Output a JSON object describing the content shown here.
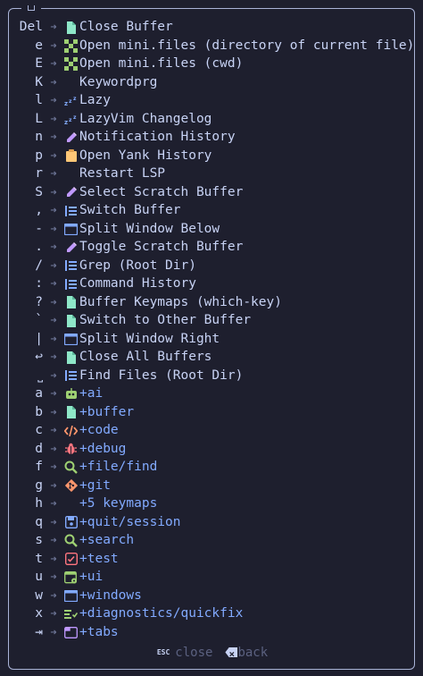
{
  "items": [
    {
      "key": "Del",
      "icon": "file",
      "label": "Close Buffer",
      "group": false
    },
    {
      "key": "e",
      "icon": "minifiles",
      "label": "Open mini.files (directory of current file)",
      "group": false
    },
    {
      "key": "E",
      "icon": "minifiles",
      "label": "Open mini.files (cwd)",
      "group": false
    },
    {
      "key": "K",
      "icon": "none",
      "label": "Keywordprg",
      "group": false
    },
    {
      "key": "l",
      "icon": "zzz",
      "label": "Lazy",
      "group": false
    },
    {
      "key": "L",
      "icon": "zzz",
      "label": "LazyVim Changelog",
      "group": false
    },
    {
      "key": "n",
      "icon": "note",
      "label": "Notification History",
      "group": false
    },
    {
      "key": "p",
      "icon": "clipboard",
      "label": "Open Yank History",
      "group": false
    },
    {
      "key": "r",
      "icon": "none",
      "label": "Restart LSP",
      "group": false
    },
    {
      "key": "S",
      "icon": "note",
      "label": "Select Scratch Buffer",
      "group": false
    },
    {
      "key": ",",
      "icon": "list",
      "label": "Switch Buffer",
      "group": false
    },
    {
      "key": "-",
      "icon": "window",
      "label": "Split Window Below",
      "group": false
    },
    {
      "key": ".",
      "icon": "note",
      "label": "Toggle Scratch Buffer",
      "group": false
    },
    {
      "key": "/",
      "icon": "list",
      "label": "Grep (Root Dir)",
      "group": false
    },
    {
      "key": ":",
      "icon": "list",
      "label": "Command History",
      "group": false
    },
    {
      "key": "?",
      "icon": "file",
      "label": "Buffer Keymaps (which-key)",
      "group": false
    },
    {
      "key": "`",
      "icon": "file",
      "label": "Switch to Other Buffer",
      "group": false
    },
    {
      "key": "|",
      "icon": "window",
      "label": "Split Window Right",
      "group": false
    },
    {
      "key": "↩",
      "icon": "file",
      "label": "Close All Buffers",
      "group": false
    },
    {
      "key": "⎵",
      "icon": "list",
      "label": "Find Files (Root Dir)",
      "group": false
    },
    {
      "key": "a",
      "icon": "robot",
      "label": "+ai",
      "group": true
    },
    {
      "key": "b",
      "icon": "file",
      "label": "+buffer",
      "group": true
    },
    {
      "key": "c",
      "icon": "code",
      "label": "+code",
      "group": true
    },
    {
      "key": "d",
      "icon": "bug",
      "label": "+debug",
      "group": true
    },
    {
      "key": "f",
      "icon": "search",
      "label": "+file/find",
      "group": true
    },
    {
      "key": "g",
      "icon": "git",
      "label": "+git",
      "group": true
    },
    {
      "key": "h",
      "icon": "none",
      "label": "+5 keymaps",
      "group": true
    },
    {
      "key": "q",
      "icon": "save",
      "label": "+quit/session",
      "group": true
    },
    {
      "key": "s",
      "icon": "search",
      "label": "+search",
      "group": true
    },
    {
      "key": "t",
      "icon": "test",
      "label": "+test",
      "group": true
    },
    {
      "key": "u",
      "icon": "ui",
      "label": "+ui",
      "group": true
    },
    {
      "key": "w",
      "icon": "window",
      "label": "+windows",
      "group": true
    },
    {
      "key": "x",
      "icon": "diagnostics",
      "label": "+diagnostics/quickfix",
      "group": true
    },
    {
      "key": "⇥",
      "icon": "tabs",
      "label": "+tabs",
      "group": true
    }
  ],
  "arrow": "➜",
  "footer": {
    "esc_key": "ESC",
    "close_label": "close",
    "back_label": "back"
  },
  "colors": {
    "background": "#1e1f2e",
    "text": "#c8d3f5",
    "group": "#82aaff",
    "muted": "#5b6180",
    "border": "#aab4d8"
  }
}
